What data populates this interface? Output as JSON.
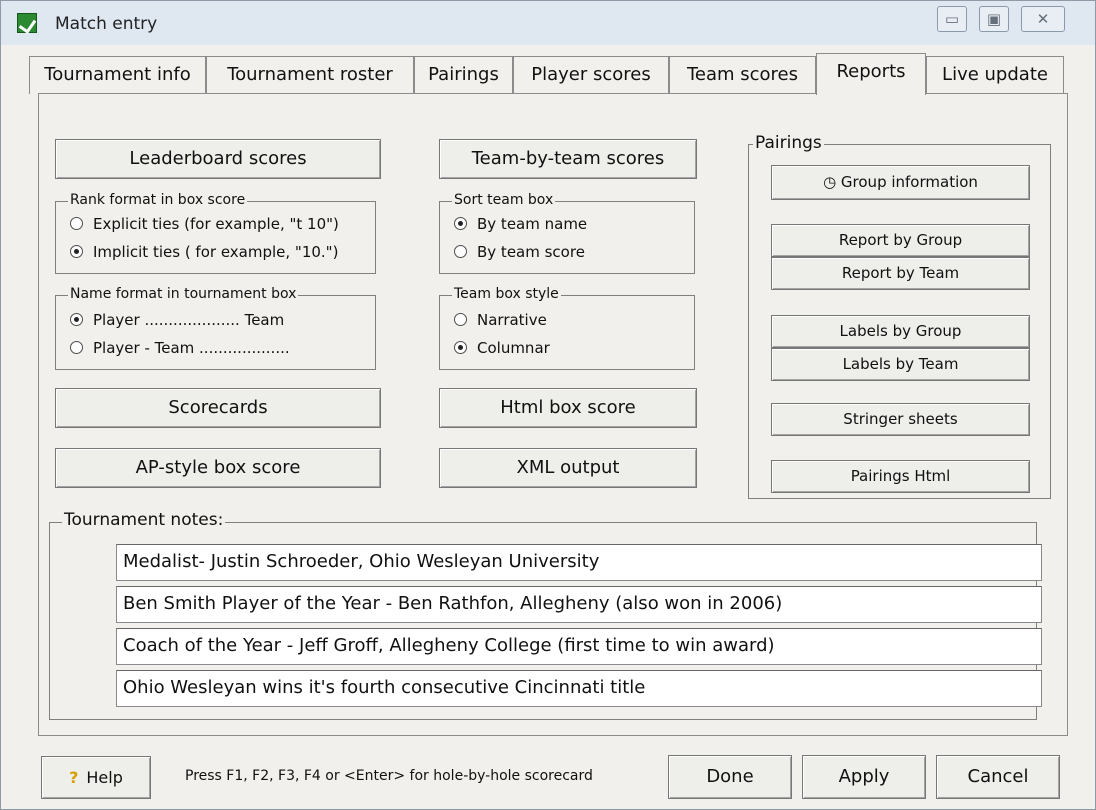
{
  "window": {
    "title": "Match entry",
    "controls": [
      "minimize-icon",
      "maximize-icon",
      "close-icon"
    ]
  },
  "tabs": [
    {
      "label": "Tournament info"
    },
    {
      "label": "Tournament roster"
    },
    {
      "label": "Pairings"
    },
    {
      "label": "Player scores"
    },
    {
      "label": "Team scores"
    },
    {
      "label": "Reports",
      "active": true
    },
    {
      "label": "Live update"
    }
  ],
  "reports": {
    "leaderboard_button": "Leaderboard scores",
    "team_by_team_button": "Team-by-team scores",
    "rank_format": {
      "legend": "Rank format in box score",
      "options": [
        {
          "label": "Explicit ties (for example, \"t 10\")",
          "selected": false
        },
        {
          "label": "Implicit ties ( for example, \"10.\")",
          "selected": true
        }
      ]
    },
    "sort_team_box": {
      "legend": "Sort team box",
      "options": [
        {
          "label": "By team name",
          "selected": true
        },
        {
          "label": "By team score",
          "selected": false
        }
      ]
    },
    "name_format": {
      "legend": "Name format in tournament box",
      "options": [
        {
          "label": "Player .................... Team",
          "selected": true
        },
        {
          "label": "Player - Team ...................",
          "selected": false
        }
      ]
    },
    "team_box_style": {
      "legend": "Team box style",
      "options": [
        {
          "label": "Narrative",
          "selected": false
        },
        {
          "label": "Columnar",
          "selected": true
        }
      ]
    },
    "scorecards_button": "Scorecards",
    "html_box_score_button": "Html box score",
    "ap_style_button": "AP-style box score",
    "xml_output_button": "XML output"
  },
  "pairings": {
    "legend": "Pairings",
    "group_information": "Group information",
    "report_by_group": "Report by Group",
    "report_by_team": "Report by Team",
    "labels_by_group": "Labels by Group",
    "labels_by_team": "Labels by Team",
    "stringer_sheets": "Stringer sheets",
    "pairings_html": "Pairings Html"
  },
  "notes": {
    "legend": "Tournament notes:",
    "lines": [
      "Medalist- Justin Schroeder, Ohio Wesleyan University",
      "Ben Smith Player of the Year - Ben Rathfon, Allegheny (also won in 2006)",
      "Coach of the Year - Jeff Groff, Allegheny College (first time to win award)",
      "Ohio Wesleyan wins it's fourth consecutive Cincinnati title"
    ]
  },
  "footer": {
    "help": "Help",
    "hint": "Press F1, F2, F3, F4 or <Enter> for hole-by-hole scorecard",
    "done": "Done",
    "apply": "Apply",
    "cancel": "Cancel"
  }
}
